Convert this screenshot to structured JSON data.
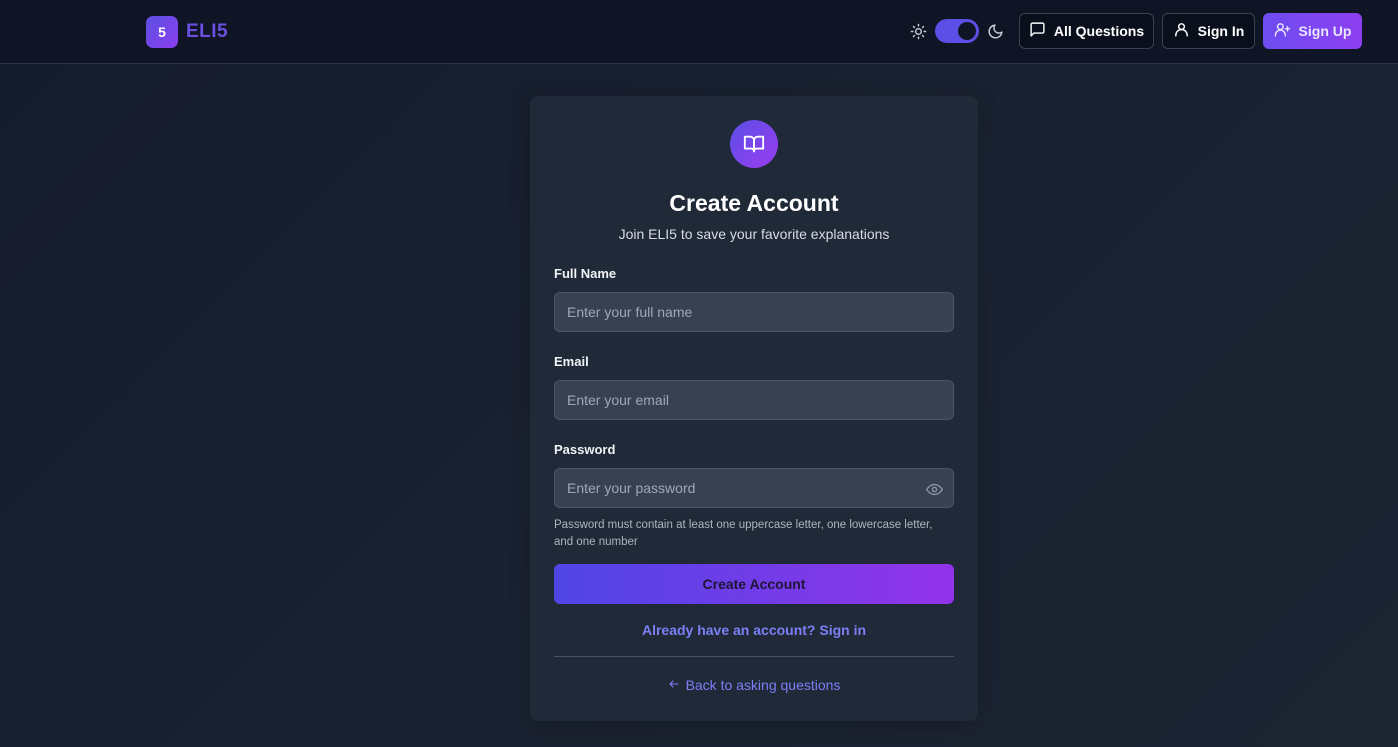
{
  "brand": {
    "badge": "5",
    "name": "ELI5"
  },
  "nav": {
    "all_questions": "All Questions",
    "sign_in": "Sign In",
    "sign_up": "Sign Up"
  },
  "theme_toggle": {
    "dark_mode": true
  },
  "form": {
    "title": "Create Account",
    "subtitle": "Join ELI5 to save your favorite explanations",
    "full_name": {
      "label": "Full Name",
      "placeholder": "Enter your full name",
      "value": ""
    },
    "email": {
      "label": "Email",
      "placeholder": "Enter your email",
      "value": ""
    },
    "password": {
      "label": "Password",
      "placeholder": "Enter your password",
      "value": ""
    },
    "password_hint": "Password must contain at least one uppercase letter, one lowercase letter, and one number",
    "submit_label": "Create Account",
    "signin_link": "Already have an account? Sign in",
    "back_link": "Back to asking questions"
  },
  "colors": {
    "accent": "#5b4fe6",
    "accent_end": "#9333ea",
    "link": "#7c7ff5",
    "background": "#141b2b",
    "card": "#202938"
  }
}
